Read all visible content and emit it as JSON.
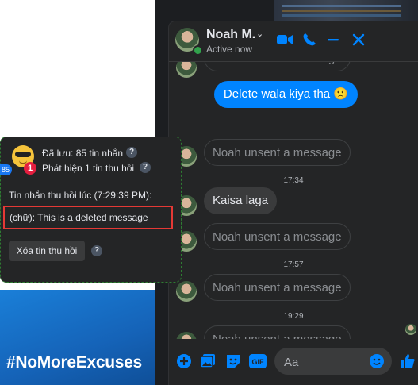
{
  "background": {
    "hashtag": "#NoMoreExcuses"
  },
  "header": {
    "name": "Noah M.",
    "status": "Active now",
    "icons": [
      "video-call-icon",
      "phone-icon",
      "minimize-icon",
      "close-icon"
    ]
  },
  "messages": {
    "unsent_text": "Noah unsent a message",
    "outgoing_1": "Delete wala kiya tha",
    "outgoing_1_emoji": "🙁",
    "time_1": "17:34",
    "incoming_1": "Kaisa laga",
    "time_2": "17:57",
    "time_3": "19:29"
  },
  "composer": {
    "placeholder": "Aa",
    "icons": [
      "plus-icon",
      "photo-icon",
      "sticker-icon",
      "gif-icon",
      "emoji-icon",
      "like-icon"
    ],
    "gif_label": "GIF"
  },
  "popup": {
    "saved_count": "Đã lưu: 85 tin nhắn",
    "detected": "Phát hiện 1 tin thu hồi",
    "badge_count": "1",
    "side_badge": "85",
    "recalled_at": "Tin nhắn thu hồi lúc (7:29:39 PM):",
    "deleted_message": "(chữ): This is a deleted message",
    "delete_button": "Xóa tin thu hồi",
    "help": "?"
  },
  "colors": {
    "messenger_blue": "#0084ff",
    "online_green": "#31a24c",
    "highlight_red": "#e53935",
    "badge_red": "#e41e3f"
  }
}
